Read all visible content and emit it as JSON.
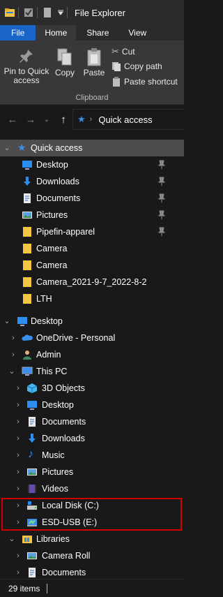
{
  "window": {
    "title": "File Explorer"
  },
  "ribbon": {
    "tabs": [
      "File",
      "Home",
      "Share",
      "View"
    ],
    "pin_label_1": "Pin to Quick",
    "pin_label_2": "access",
    "copy_label": "Copy",
    "paste_label": "Paste",
    "cut_label": "Cut",
    "copy_path_label": "Copy path",
    "paste_shortcut_label": "Paste shortcut",
    "group_label": "Clipboard"
  },
  "address": {
    "path": "Quick access"
  },
  "tree": {
    "quick_access": "Quick access",
    "qa_items": [
      "Desktop",
      "Downloads",
      "Documents",
      "Pictures",
      "Pipefin-apparel",
      "Camera",
      "Camera",
      "Camera_2021-9-7_2022-8-2",
      "LTH"
    ],
    "desktop": "Desktop",
    "onedrive": "OneDrive - Personal",
    "admin": "Admin",
    "this_pc": "This PC",
    "pc_items": [
      "3D Objects",
      "Desktop",
      "Documents",
      "Downloads",
      "Music",
      "Pictures",
      "Videos",
      "Local Disk (C:)",
      "ESD-USB (E:)"
    ],
    "libraries": "Libraries",
    "lib_items": [
      "Camera Roll",
      "Documents"
    ]
  },
  "status": {
    "item_count": "29 items"
  },
  "colors": {
    "accent": "#1a66c8",
    "highlight": "#d40000",
    "folder": "#f5c542"
  }
}
